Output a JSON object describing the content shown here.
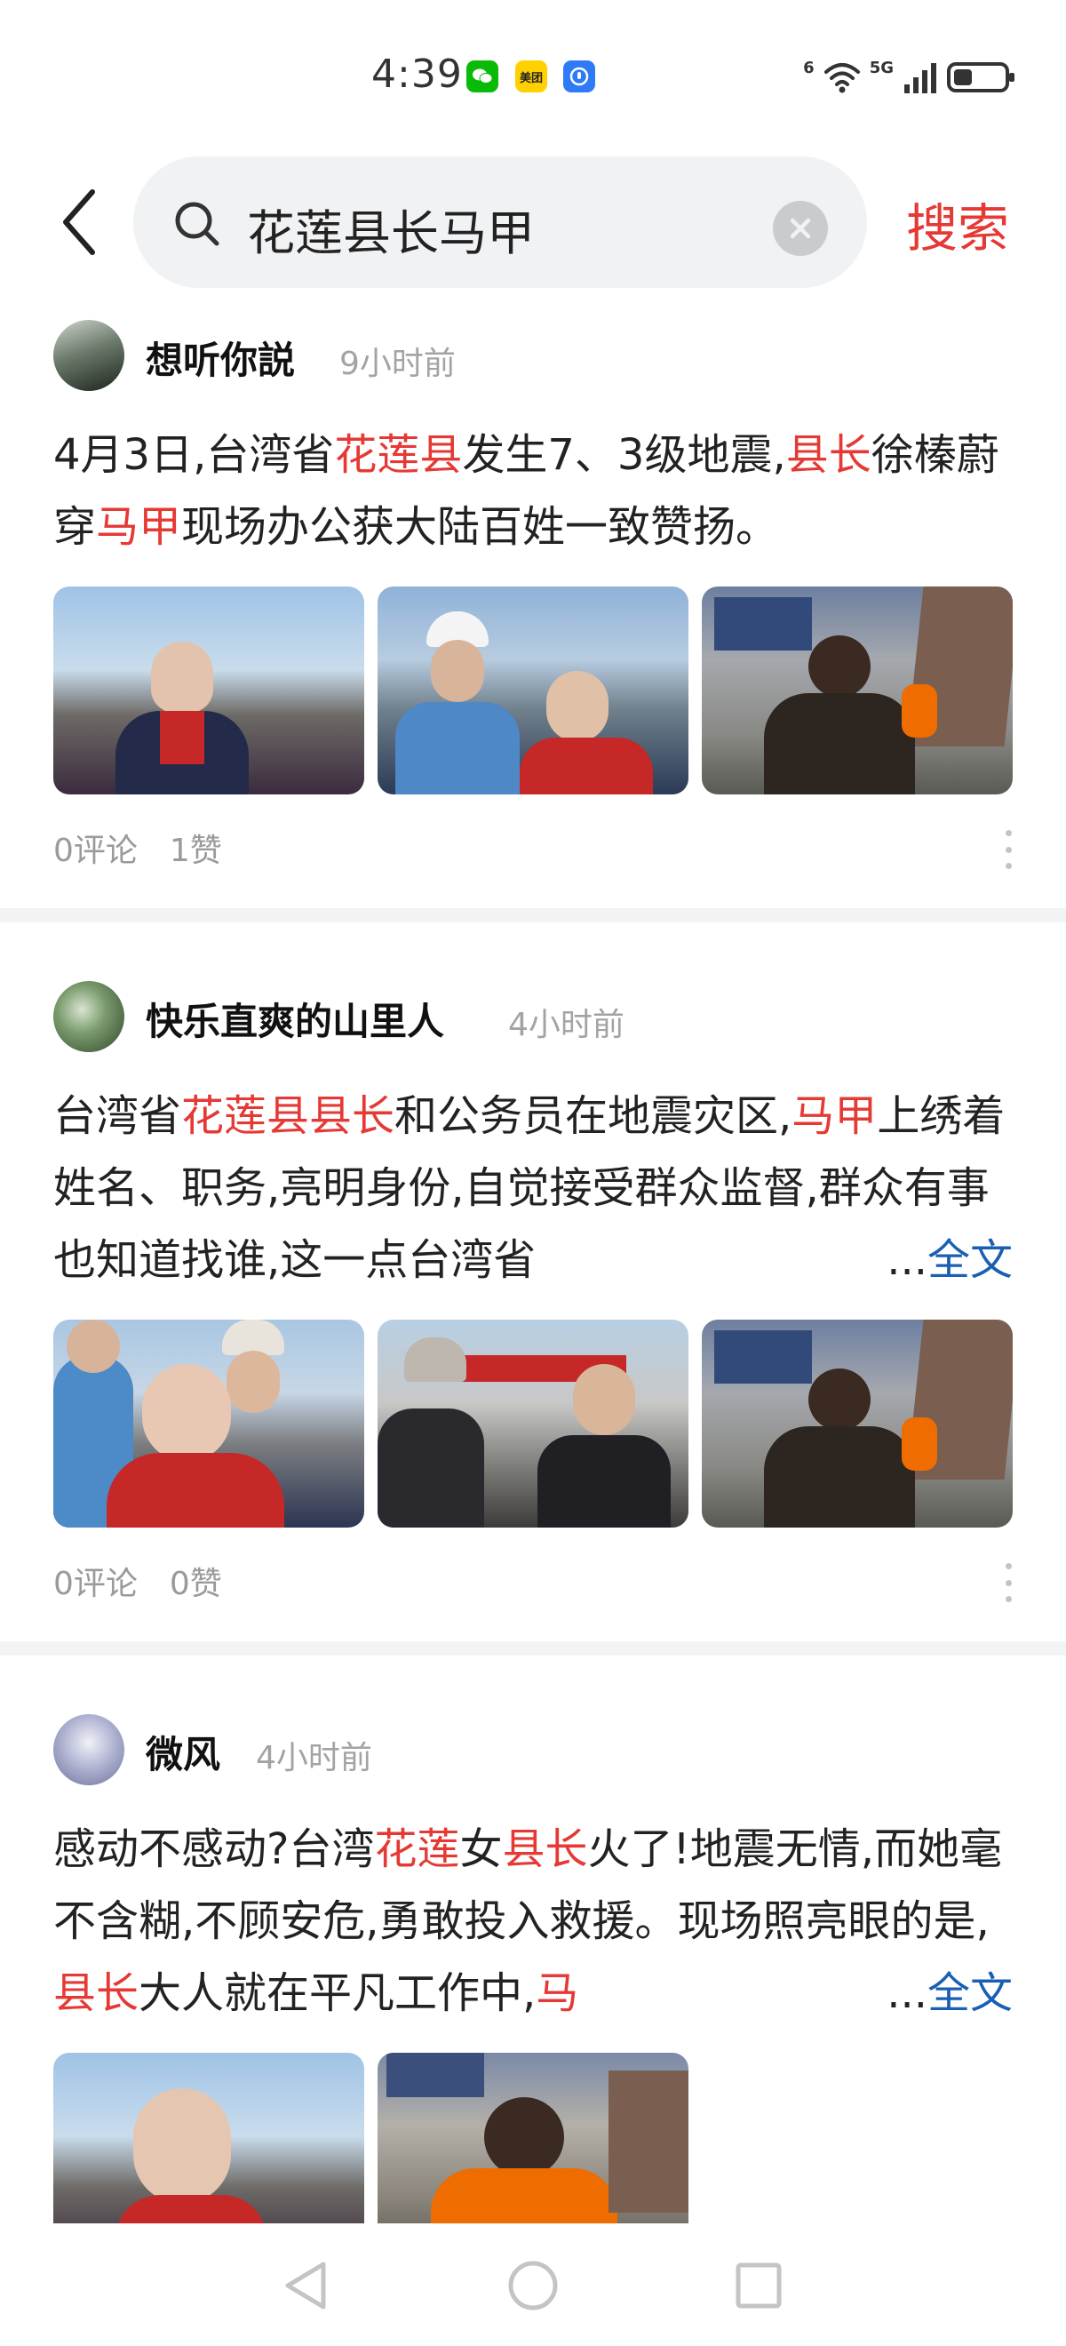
{
  "status_bar": {
    "time": "4:39",
    "apps": [
      "wechat-icon",
      "meituan-icon",
      "app-icon"
    ],
    "meituan_label": "美团",
    "network": "5G",
    "wifi_badge": "6"
  },
  "search": {
    "query": "花莲县长马甲",
    "submit_label": "搜索"
  },
  "posts": [
    {
      "author": "想听你説",
      "time": "9小时前",
      "segments": [
        {
          "t": "4月3日,台湾省",
          "hl": false
        },
        {
          "t": "花莲县",
          "hl": true
        },
        {
          "t": "发生7、3级地震,",
          "hl": false
        },
        {
          "t": "县长",
          "hl": true
        },
        {
          "t": "徐榛蔚穿",
          "hl": false
        },
        {
          "t": "马甲",
          "hl": true
        },
        {
          "t": "现场办公获大陆百姓一致赞扬。",
          "hl": false
        }
      ],
      "truncated": false,
      "images": 3,
      "comments": "0评论",
      "likes": "1赞"
    },
    {
      "author": "快乐直爽的山里人",
      "time": "4小时前",
      "segments": [
        {
          "t": "台湾省",
          "hl": false
        },
        {
          "t": "花莲县县长",
          "hl": true
        },
        {
          "t": "和公务员在地震灾区,",
          "hl": false
        },
        {
          "t": "马甲",
          "hl": true
        },
        {
          "t": "上绣着姓名、职务,亮明身份,自觉接受群众监督,群众有事也知道找谁,这一点台湾省",
          "hl": false
        }
      ],
      "truncated": true,
      "images": 3,
      "comments": "0评论",
      "likes": "0赞"
    },
    {
      "author": "微风",
      "time": "4小时前",
      "segments": [
        {
          "t": "感动不感动?台湾",
          "hl": false
        },
        {
          "t": "花莲",
          "hl": true
        },
        {
          "t": "女",
          "hl": false
        },
        {
          "t": "县长",
          "hl": true
        },
        {
          "t": "火了!地震无情,而她毫不含糊,不顾安危,勇敢投入救援。现场照亮眼的是,",
          "hl": false
        },
        {
          "t": "县长",
          "hl": true
        },
        {
          "t": "大人就在平凡工作中,",
          "hl": false
        },
        {
          "t": "马",
          "hl": true
        }
      ],
      "truncated": true,
      "images": 2,
      "comments": "",
      "likes": ""
    }
  ],
  "more_label": {
    "ellipsis": "...",
    "full": "全文"
  },
  "colors": {
    "highlight": "#e53935",
    "link": "#1a5fb4",
    "search_bg": "#f1f2f4"
  }
}
